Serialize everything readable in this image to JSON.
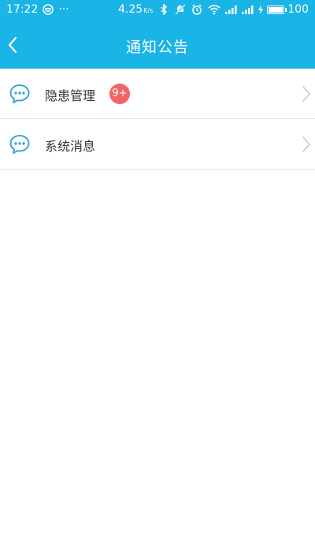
{
  "status_bar": {
    "time": "17:22",
    "dots": "···",
    "network_speed": "4.25",
    "network_speed_unit": "K/s",
    "battery_percent": "100",
    "icons": [
      "face-icon",
      "bluetooth-icon",
      "mute-icon",
      "alarm-icon",
      "wifi-icon",
      "signal-icon",
      "signal-icon",
      "charging-icon",
      "battery-icon"
    ]
  },
  "nav": {
    "title": "通知公告",
    "back_icon": "chevron-left-icon"
  },
  "list": {
    "items": [
      {
        "label": "隐患管理",
        "badge": "9+",
        "icon": "chat-bubble-icon"
      },
      {
        "label": "系统消息",
        "icon": "chat-bubble-icon"
      }
    ]
  },
  "colors": {
    "header_bg": "#1ab4e6",
    "icon_blue": "#3aa6d8",
    "badge_bg": "#f06666",
    "text": "#333333",
    "divider": "#e6e6e6",
    "chevron": "#c8c8c8"
  }
}
